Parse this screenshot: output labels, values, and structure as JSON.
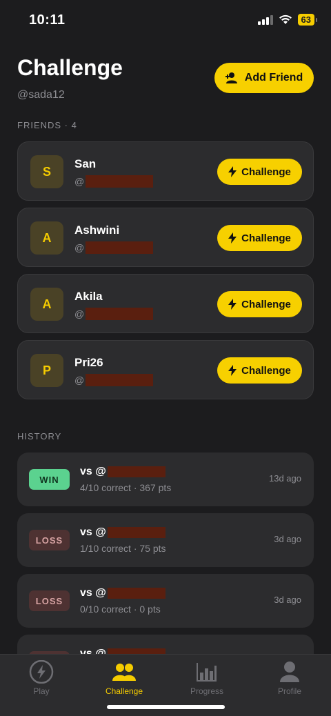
{
  "status": {
    "time": "10:11",
    "battery": "63"
  },
  "header": {
    "title": "Challenge",
    "handle": "@sada12",
    "add_friend_label": "Add Friend"
  },
  "friends": {
    "section_label": "FRIENDS · 4",
    "items": [
      {
        "initial": "S",
        "name": "San",
        "handle_prefix": "@",
        "action": "Challenge"
      },
      {
        "initial": "A",
        "name": "Ashwini",
        "handle_prefix": "@",
        "action": "Challenge"
      },
      {
        "initial": "A",
        "name": "Akila",
        "handle_prefix": "@",
        "action": "Challenge"
      },
      {
        "initial": "P",
        "name": "Pri26",
        "handle_prefix": "@",
        "action": "Challenge"
      }
    ]
  },
  "history": {
    "section_label": "HISTORY",
    "items": [
      {
        "result": "WIN",
        "opponent_prefix": "vs @",
        "score": "4/10 correct · 367 pts",
        "ago": "13d ago"
      },
      {
        "result": "LOSS",
        "opponent_prefix": "vs @",
        "score": "1/10 correct · 75 pts",
        "ago": "3d ago"
      },
      {
        "result": "LOSS",
        "opponent_prefix": "vs @",
        "score": "0/10 correct · 0 pts",
        "ago": "3d ago"
      },
      {
        "result": "",
        "opponent_prefix": "vs @",
        "score": "",
        "ago": ""
      }
    ]
  },
  "tabs": [
    {
      "label": "Play",
      "icon": "lightning-icon"
    },
    {
      "label": "Challenge",
      "icon": "users-icon",
      "active": true
    },
    {
      "label": "Progress",
      "icon": "bar-chart-icon"
    },
    {
      "label": "Profile",
      "icon": "person-icon"
    }
  ],
  "colors": {
    "accent": "#f7d000",
    "win": "#5bd28f",
    "loss": "#4e3232",
    "background": "#1c1c1e",
    "card": "#2c2c2e"
  }
}
